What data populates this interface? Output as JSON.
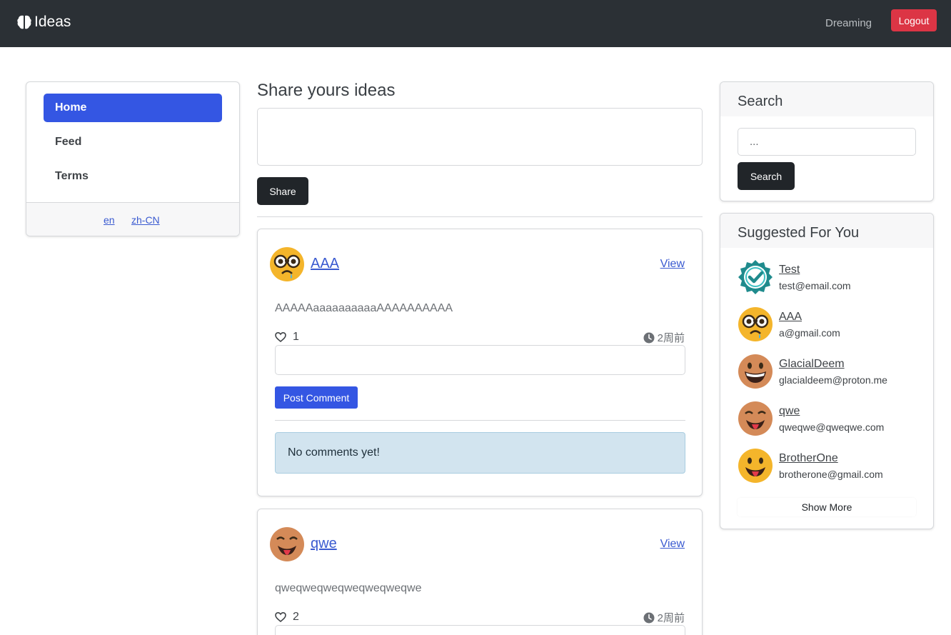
{
  "app": {
    "brand": "Ideas",
    "user": "Dreaming",
    "logout_label": "Logout"
  },
  "sidebar": {
    "items": [
      {
        "label": "Home",
        "active": true
      },
      {
        "label": "Feed",
        "active": false
      },
      {
        "label": "Terms",
        "active": false
      }
    ],
    "languages": [
      "en",
      "zh-CN"
    ]
  },
  "share": {
    "title": "Share yours ideas",
    "button_label": "Share"
  },
  "posts": [
    {
      "username": "AAA",
      "avatar_icon": "nerd-face-icon",
      "view_label": "View",
      "content": "AAAAAaaaaaaaaaaAAAAAAAAAA",
      "likes": "1",
      "time": "2周前",
      "comment_button": "Post Comment",
      "empty_comments": "No comments yet!"
    },
    {
      "username": "qwe",
      "avatar_icon": "tongue-face-icon",
      "view_label": "View",
      "content": "qweqweqweqweqweqweqwe",
      "likes": "2",
      "time": "2周前"
    }
  ],
  "search": {
    "title": "Search",
    "placeholder": "...",
    "button_label": "Search"
  },
  "suggested": {
    "title": "Suggested For You",
    "users": [
      {
        "name": "Test",
        "email": "test@email.com",
        "avatar_icon": "verified-badge-icon"
      },
      {
        "name": "AAA",
        "email": "a@gmail.com",
        "avatar_icon": "nerd-face-icon"
      },
      {
        "name": "GlacialDeem",
        "email": "glacialdeem@proton.me",
        "avatar_icon": "grinning-face-icon"
      },
      {
        "name": "qwe",
        "email": "qweqwe@qweqwe.com",
        "avatar_icon": "tongue-face-icon"
      },
      {
        "name": "BrotherOne",
        "email": "brotherone@gmail.com",
        "avatar_icon": "yellow-tongue-face-icon"
      }
    ],
    "show_more": "Show More"
  },
  "colors": {
    "navbar": "#2b3035",
    "primary": "#3456e3",
    "danger": "#dc3545",
    "dark_button": "#212529",
    "info_alert": "#d2e4ef"
  }
}
